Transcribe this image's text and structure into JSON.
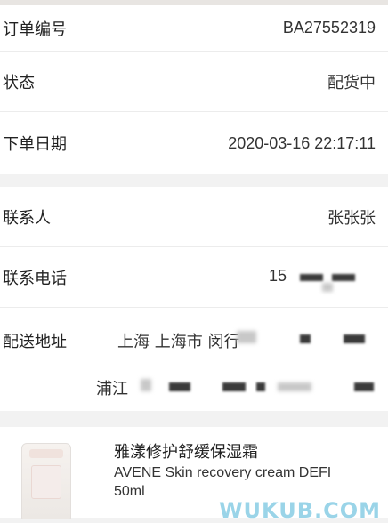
{
  "order": {
    "number_label": "订单编号",
    "number_value": "BA27552319",
    "status_label": "状态",
    "status_value": "配货中",
    "date_label": "下单日期",
    "date_value": "2020-03-16 22:17:11"
  },
  "contact": {
    "name_label": "联系人",
    "name_value": "张张张",
    "phone_label": "联系电话",
    "phone_value": "15",
    "address_label": "配送地址",
    "address_line1": "上海 上海市 闵行",
    "address_line2": "浦江"
  },
  "product": {
    "name_cn": "雅漾修护舒缓保湿霜",
    "name_en": "AVENE Skin recovery cream DEFI 50ml"
  },
  "watermark": "WUKUB.COM"
}
